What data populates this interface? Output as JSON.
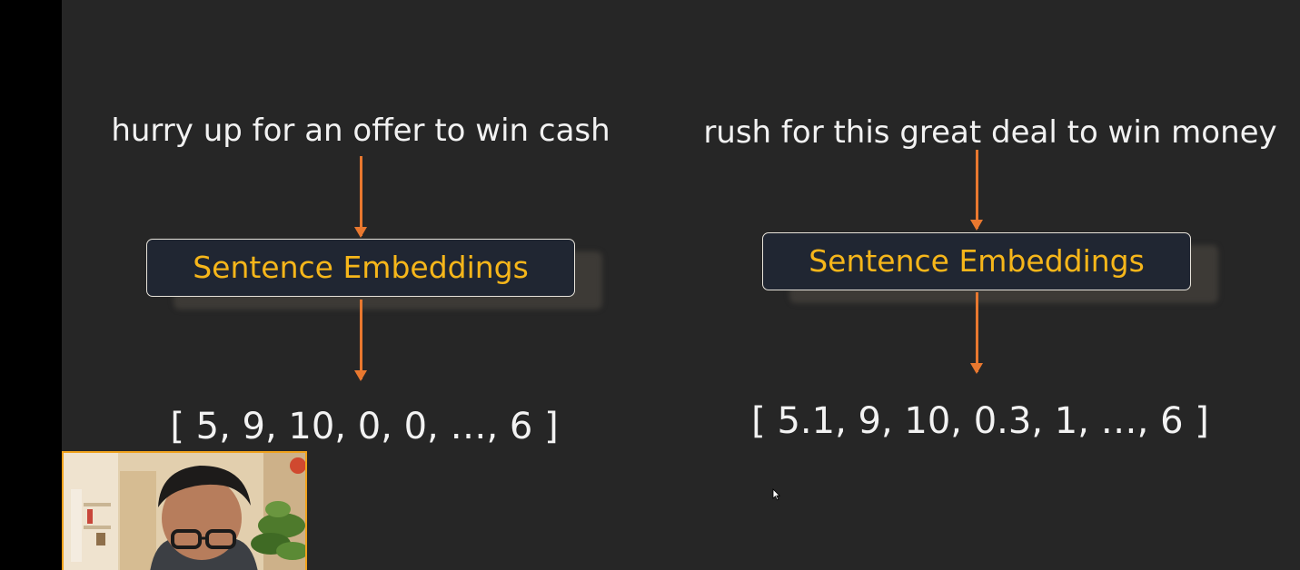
{
  "left_flow": {
    "sentence": "hurry up for an offer to win cash",
    "box_label": "Sentence Embeddings",
    "vector": "[ 5, 9, 10, 0, 0, …, 6 ]"
  },
  "right_flow": {
    "sentence": "rush for this great deal to win money",
    "box_label": "Sentence Embeddings",
    "vector": "[ 5.1, 9, 10, 0.3, 1, …, 6 ]"
  },
  "colors": {
    "background": "#262626",
    "text": "#f2f2f2",
    "box_text": "#f6b61a",
    "arrow": "#e9782f",
    "webcam_border": "#f0a21c"
  },
  "icons": [
    "arrow-down-icon",
    "mouse-cursor-icon"
  ]
}
